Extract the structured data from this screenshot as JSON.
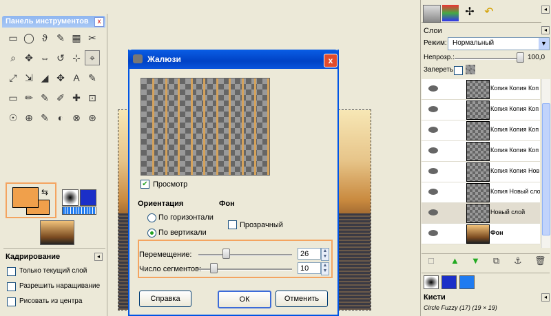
{
  "toolbox": {
    "title": "Панель инструментов",
    "close": "x",
    "tools": [
      "▭",
      "◯",
      "ϑ",
      "✎",
      "▦",
      "✂",
      "⌕",
      "✥",
      "⇔",
      "↺",
      "⊹",
      "⌖",
      "⤢",
      "⇲",
      "◢",
      "✥",
      "A",
      "✎",
      "▭",
      "✏",
      "✎",
      "✐",
      "✚",
      "⊡",
      "☉",
      "⊕",
      "✎",
      "◐",
      "⊗",
      "⊛"
    ],
    "options_title": "Кадрирование",
    "opt1": "Только текущий слой",
    "opt2": "Разрешить наращивание",
    "opt3": "Рисовать из центра"
  },
  "dialog": {
    "title": "Жалюзи",
    "close": "x",
    "preview_label": "Просмотр",
    "orientation_label": "Ориентация",
    "horizontal": "По горизонтали",
    "vertical": "По вертикали",
    "background_label": "Фон",
    "transparent": "Прозрачный",
    "displacement_label": "Перемещение:",
    "displacement_value": "26",
    "segments_label": "Число сегментов:",
    "segments_value": "10",
    "displacement_fraction": 0.26,
    "segments_fraction": 0.02,
    "help_button": "Справка",
    "ok_button": "ОК",
    "cancel_button": "Отменить"
  },
  "layers": {
    "title": "Слои",
    "mode_label": "Режим:",
    "mode_value": "Нормальный",
    "opacity_label": "Непрозр.:",
    "opacity_value": "100,0",
    "lock_label": "Запереть:",
    "rows": [
      {
        "name": "Копия Копия Коп"
      },
      {
        "name": "Копия Копия Коп"
      },
      {
        "name": "Копия Копия Коп"
      },
      {
        "name": "Копия Копия Коп"
      },
      {
        "name": "Копия Копия Нов"
      },
      {
        "name": "Копия Новый сло"
      },
      {
        "name": "Новый слой"
      },
      {
        "name": "Фон"
      }
    ]
  },
  "brushes": {
    "title": "Кисти",
    "current": "Circle Fuzzy (17) (19 × 19)"
  },
  "colors": {
    "foreground": "#f0a04b",
    "accent": "#0055e5",
    "highlight": "#f4a460"
  }
}
